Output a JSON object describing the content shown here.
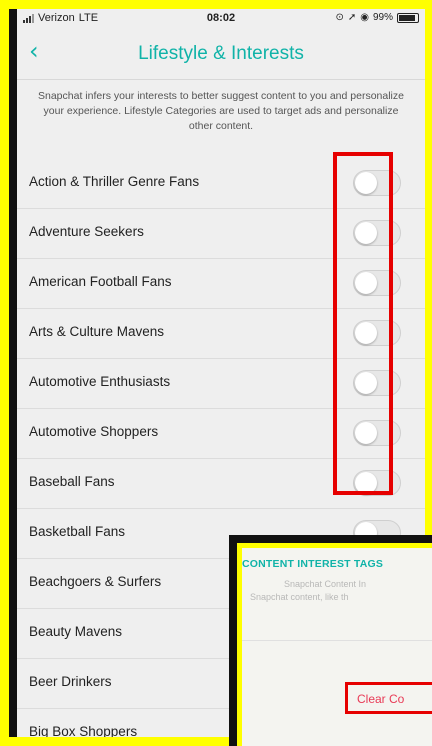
{
  "status_bar": {
    "carrier": "Verizon",
    "network": "LTE",
    "time": "08:02",
    "battery": "99%"
  },
  "header": {
    "back_icon": "chevron-left-icon",
    "title": "Lifestyle & Interests"
  },
  "description": "Snapchat infers your interests to better suggest content to you and personalize your experience. Lifestyle Categories are used to target ads and personalize other content.",
  "categories": [
    {
      "label": "Action & Thriller Genre Fans",
      "enabled": false
    },
    {
      "label": "Adventure Seekers",
      "enabled": false
    },
    {
      "label": "American Football Fans",
      "enabled": false
    },
    {
      "label": "Arts & Culture Mavens",
      "enabled": false
    },
    {
      "label": "Automotive Enthusiasts",
      "enabled": false
    },
    {
      "label": "Automotive Shoppers",
      "enabled": false
    },
    {
      "label": "Baseball Fans",
      "enabled": false
    },
    {
      "label": "Basketball Fans",
      "enabled": false
    },
    {
      "label": "Beachgoers & Surfers",
      "enabled": false
    },
    {
      "label": "Beauty Mavens",
      "enabled": false
    },
    {
      "label": "Beer Drinkers",
      "enabled": false
    },
    {
      "label": "Big Box Shoppers",
      "enabled": false
    }
  ],
  "overlay": {
    "header": "CONTENT INTEREST TAGS",
    "desc_line1": "Snapchat Content In",
    "desc_line2": "Snapchat content, like th",
    "clear_label": "Clear Co"
  },
  "colors": {
    "accent": "#10b3a8",
    "highlight_border": "#e60000",
    "frame": "#ffff00",
    "clear_text": "#e83a56"
  }
}
